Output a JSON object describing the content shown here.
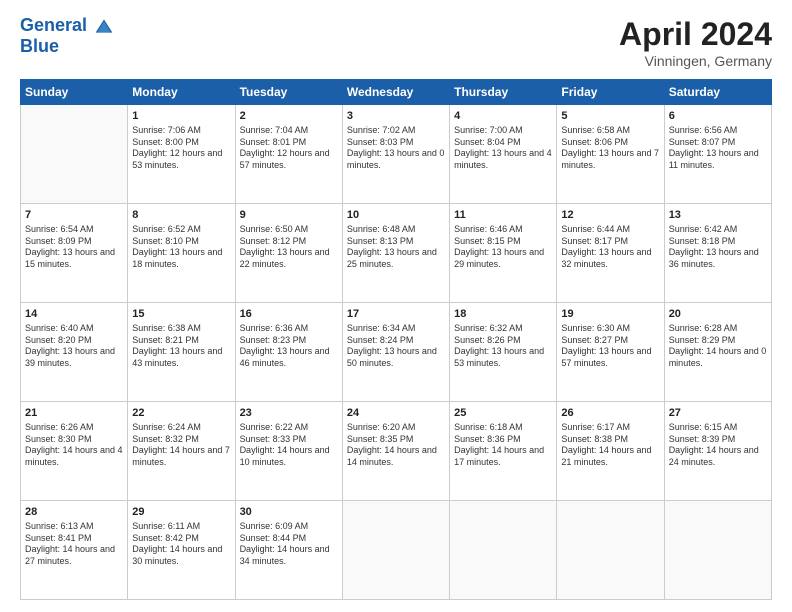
{
  "header": {
    "logo_line1": "General",
    "logo_line2": "Blue",
    "month": "April 2024",
    "location": "Vinningen, Germany"
  },
  "weekdays": [
    "Sunday",
    "Monday",
    "Tuesday",
    "Wednesday",
    "Thursday",
    "Friday",
    "Saturday"
  ],
  "weeks": [
    [
      {
        "day": "",
        "empty": true
      },
      {
        "day": "1",
        "sunrise": "7:06 AM",
        "sunset": "8:00 PM",
        "daylight": "12 hours and 53 minutes."
      },
      {
        "day": "2",
        "sunrise": "7:04 AM",
        "sunset": "8:01 PM",
        "daylight": "12 hours and 57 minutes."
      },
      {
        "day": "3",
        "sunrise": "7:02 AM",
        "sunset": "8:03 PM",
        "daylight": "13 hours and 0 minutes."
      },
      {
        "day": "4",
        "sunrise": "7:00 AM",
        "sunset": "8:04 PM",
        "daylight": "13 hours and 4 minutes."
      },
      {
        "day": "5",
        "sunrise": "6:58 AM",
        "sunset": "8:06 PM",
        "daylight": "13 hours and 7 minutes."
      },
      {
        "day": "6",
        "sunrise": "6:56 AM",
        "sunset": "8:07 PM",
        "daylight": "13 hours and 11 minutes."
      }
    ],
    [
      {
        "day": "7",
        "sunrise": "6:54 AM",
        "sunset": "8:09 PM",
        "daylight": "13 hours and 15 minutes."
      },
      {
        "day": "8",
        "sunrise": "6:52 AM",
        "sunset": "8:10 PM",
        "daylight": "13 hours and 18 minutes."
      },
      {
        "day": "9",
        "sunrise": "6:50 AM",
        "sunset": "8:12 PM",
        "daylight": "13 hours and 22 minutes."
      },
      {
        "day": "10",
        "sunrise": "6:48 AM",
        "sunset": "8:13 PM",
        "daylight": "13 hours and 25 minutes."
      },
      {
        "day": "11",
        "sunrise": "6:46 AM",
        "sunset": "8:15 PM",
        "daylight": "13 hours and 29 minutes."
      },
      {
        "day": "12",
        "sunrise": "6:44 AM",
        "sunset": "8:17 PM",
        "daylight": "13 hours and 32 minutes."
      },
      {
        "day": "13",
        "sunrise": "6:42 AM",
        "sunset": "8:18 PM",
        "daylight": "13 hours and 36 minutes."
      }
    ],
    [
      {
        "day": "14",
        "sunrise": "6:40 AM",
        "sunset": "8:20 PM",
        "daylight": "13 hours and 39 minutes."
      },
      {
        "day": "15",
        "sunrise": "6:38 AM",
        "sunset": "8:21 PM",
        "daylight": "13 hours and 43 minutes."
      },
      {
        "day": "16",
        "sunrise": "6:36 AM",
        "sunset": "8:23 PM",
        "daylight": "13 hours and 46 minutes."
      },
      {
        "day": "17",
        "sunrise": "6:34 AM",
        "sunset": "8:24 PM",
        "daylight": "13 hours and 50 minutes."
      },
      {
        "day": "18",
        "sunrise": "6:32 AM",
        "sunset": "8:26 PM",
        "daylight": "13 hours and 53 minutes."
      },
      {
        "day": "19",
        "sunrise": "6:30 AM",
        "sunset": "8:27 PM",
        "daylight": "13 hours and 57 minutes."
      },
      {
        "day": "20",
        "sunrise": "6:28 AM",
        "sunset": "8:29 PM",
        "daylight": "14 hours and 0 minutes."
      }
    ],
    [
      {
        "day": "21",
        "sunrise": "6:26 AM",
        "sunset": "8:30 PM",
        "daylight": "14 hours and 4 minutes."
      },
      {
        "day": "22",
        "sunrise": "6:24 AM",
        "sunset": "8:32 PM",
        "daylight": "14 hours and 7 minutes."
      },
      {
        "day": "23",
        "sunrise": "6:22 AM",
        "sunset": "8:33 PM",
        "daylight": "14 hours and 10 minutes."
      },
      {
        "day": "24",
        "sunrise": "6:20 AM",
        "sunset": "8:35 PM",
        "daylight": "14 hours and 14 minutes."
      },
      {
        "day": "25",
        "sunrise": "6:18 AM",
        "sunset": "8:36 PM",
        "daylight": "14 hours and 17 minutes."
      },
      {
        "day": "26",
        "sunrise": "6:17 AM",
        "sunset": "8:38 PM",
        "daylight": "14 hours and 21 minutes."
      },
      {
        "day": "27",
        "sunrise": "6:15 AM",
        "sunset": "8:39 PM",
        "daylight": "14 hours and 24 minutes."
      }
    ],
    [
      {
        "day": "28",
        "sunrise": "6:13 AM",
        "sunset": "8:41 PM",
        "daylight": "14 hours and 27 minutes."
      },
      {
        "day": "29",
        "sunrise": "6:11 AM",
        "sunset": "8:42 PM",
        "daylight": "14 hours and 30 minutes."
      },
      {
        "day": "30",
        "sunrise": "6:09 AM",
        "sunset": "8:44 PM",
        "daylight": "14 hours and 34 minutes."
      },
      {
        "day": "",
        "empty": true
      },
      {
        "day": "",
        "empty": true
      },
      {
        "day": "",
        "empty": true
      },
      {
        "day": "",
        "empty": true
      }
    ]
  ]
}
